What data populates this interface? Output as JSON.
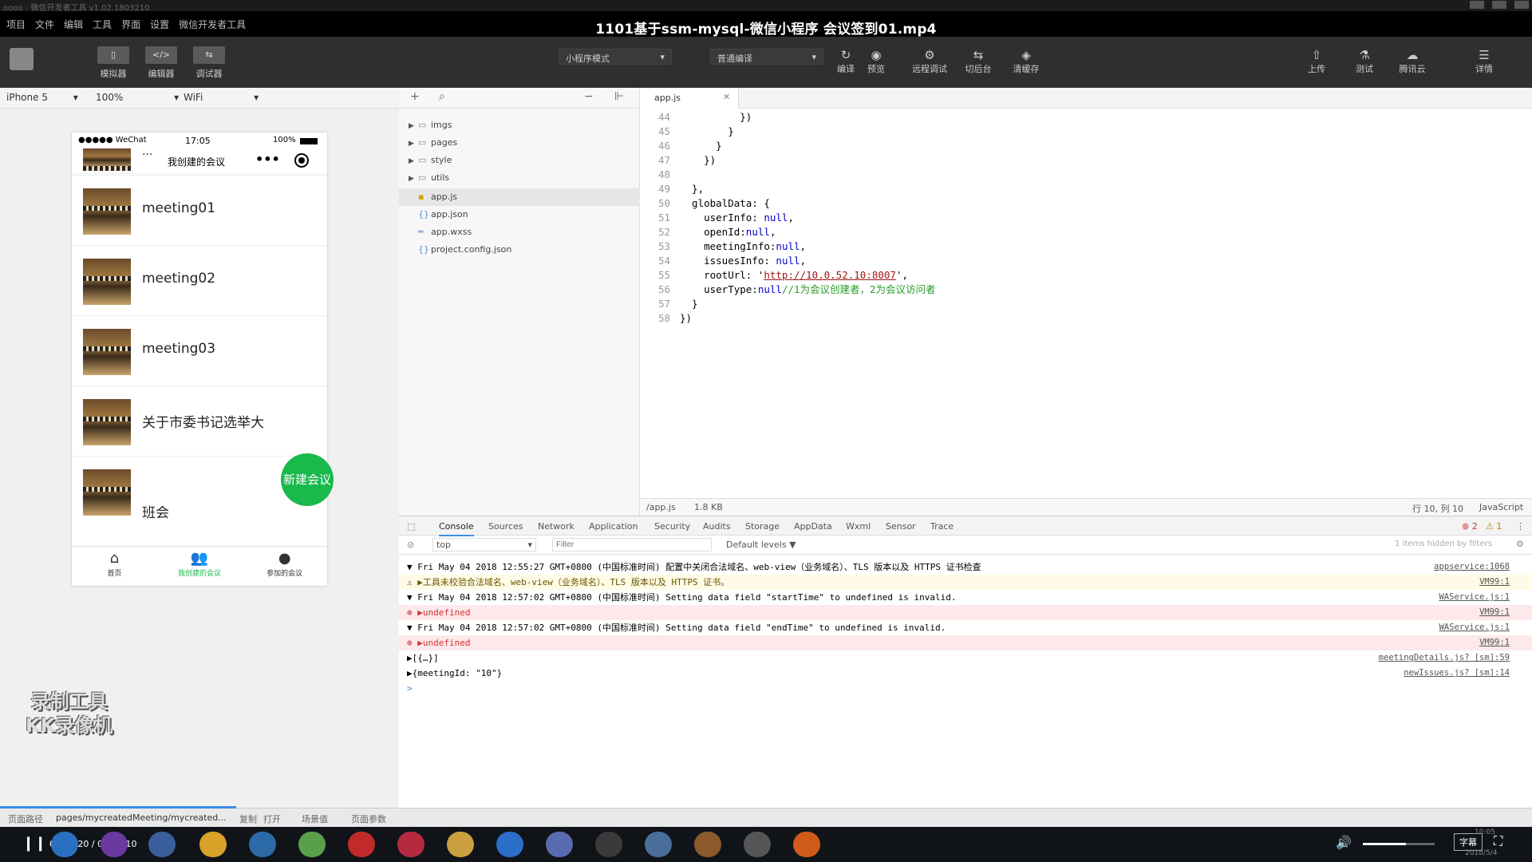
{
  "window": {
    "app_title": "oooo - 微信开发者工具 v1.02.1803210",
    "video_title": "1101基于ssm-mysql-微信小程序 会议签到01.mp4"
  },
  "menu": [
    "项目",
    "文件",
    "编辑",
    "工具",
    "界面",
    "设置",
    "微信开发者工具"
  ],
  "toolbar": {
    "left_buttons": [
      {
        "label": "模拟器",
        "icon": "phone-icon"
      },
      {
        "label": "编辑器",
        "icon": "code-icon"
      },
      {
        "label": "调试器",
        "icon": "debug-icon"
      }
    ],
    "mode_select": "小程序模式",
    "compile_select": "普通编译",
    "actions": [
      {
        "label": "编译",
        "icon": "refresh-icon",
        "glyph": "↻"
      },
      {
        "label": "预览",
        "icon": "eye-icon",
        "glyph": "◉"
      },
      {
        "label": "远程调试",
        "icon": "remote-debug-icon",
        "glyph": "⚙"
      },
      {
        "label": "切后台",
        "icon": "background-icon",
        "glyph": "⇆"
      },
      {
        "label": "清缓存",
        "icon": "clear-cache-icon",
        "glyph": "◈"
      }
    ],
    "right_actions": [
      {
        "label": "上传",
        "icon": "upload-icon",
        "glyph": "⇧"
      },
      {
        "label": "测试",
        "icon": "test-icon",
        "glyph": "⚗"
      },
      {
        "label": "腾讯云",
        "icon": "cloud-icon",
        "glyph": "☁"
      },
      {
        "label": "详情",
        "icon": "menu-icon",
        "glyph": "☰"
      }
    ]
  },
  "device": {
    "model": "iPhone 5",
    "zoom": "100%",
    "network": "WiFi"
  },
  "phone": {
    "carrier": "●●●●● WeChat",
    "time": "17:05",
    "battery": "100%",
    "nav_title": "我创建的会议",
    "partial_item": "...",
    "meetings": [
      "meeting01",
      "meeting02",
      "meeting03",
      "关于市委书记选举大"
    ],
    "last_item": "班会",
    "fab_label": "新建会议",
    "tabs": [
      "首页",
      "我创建的会议",
      "参加的会议"
    ]
  },
  "watermark": [
    "录制工具",
    "KK录像机"
  ],
  "filetree": {
    "items": [
      {
        "name": "imgs",
        "type": "folder"
      },
      {
        "name": "pages",
        "type": "folder"
      },
      {
        "name": "style",
        "type": "folder"
      },
      {
        "name": "utils",
        "type": "folder"
      },
      {
        "name": "app.js",
        "type": "js"
      },
      {
        "name": "app.json",
        "type": "json"
      },
      {
        "name": "app.wxss",
        "type": "wxss"
      },
      {
        "name": "project.config.json",
        "type": "json"
      }
    ]
  },
  "editor": {
    "tab": "app.js",
    "lines": [
      {
        "n": "44",
        "text": "          })"
      },
      {
        "n": "45",
        "text": "        }"
      },
      {
        "n": "46",
        "text": "      }"
      },
      {
        "n": "47",
        "text": "    })"
      },
      {
        "n": "48",
        "text": ""
      },
      {
        "n": "49",
        "text": "  },"
      },
      {
        "n": "50",
        "text": "  globalData: {"
      },
      {
        "n": "51",
        "text": "    userInfo: ",
        "kw": "null",
        "tail": ","
      },
      {
        "n": "52",
        "text": "    openId:",
        "kw": "null",
        "tail": ","
      },
      {
        "n": "53",
        "text": "    meetingInfo:",
        "kw": "null",
        "tail": ","
      },
      {
        "n": "54",
        "text": "    issuesInfo: ",
        "kw": "null",
        "tail": ","
      },
      {
        "n": "55",
        "text": "    rootUrl: '",
        "str": "http://10.0.52.10:8007",
        "tail": "',"
      },
      {
        "n": "56",
        "text": "    userType:",
        "kw": "null",
        "cm": "//1为会议创建者，2为会议访问者"
      },
      {
        "n": "57",
        "text": "  }"
      },
      {
        "n": "58",
        "text": "})"
      }
    ],
    "status_path": "/app.js",
    "status_size": "1.8 KB",
    "status_pos": "行 10, 列 10",
    "status_lang": "JavaScript"
  },
  "console": {
    "tabs": [
      "Console",
      "Sources",
      "Network",
      "Application",
      "Security",
      "Audits",
      "Storage",
      "AppData",
      "Wxml",
      "Sensor",
      "Trace"
    ],
    "error_count": "2",
    "warn_count": "1",
    "context": "top",
    "filter_placeholder": "Filter",
    "levels": "Default levels ▼",
    "hidden_note": "1 items hidden by filters",
    "lines": [
      {
        "type": "log",
        "text": "▼ Fri May 04 2018 12:55:27 GMT+0800 (中国标准时间) 配置中关闭合法域名、web-view（业务域名）、TLS 版本以及 HTTPS 证书检查",
        "src": "appservice:1068"
      },
      {
        "type": "warn",
        "text": "  ⚠ ▶工具未校验合法域名、web-view（业务域名）、TLS 版本以及 HTTPS 证书。",
        "src": "VM99:1"
      },
      {
        "type": "log",
        "text": "▼ Fri May 04 2018 12:57:02 GMT+0800 (中国标准时间) Setting data field \"startTime\" to undefined is invalid.",
        "src": "WAService.js:1"
      },
      {
        "type": "err",
        "text": "  ⊗ ▶undefined",
        "src": "VM99:1"
      },
      {
        "type": "log",
        "text": "▼ Fri May 04 2018 12:57:02 GMT+0800 (中国标准时间) Setting data field \"endTime\" to undefined is invalid.",
        "src": "WAService.js:1"
      },
      {
        "type": "err",
        "text": "  ⊗ ▶undefined",
        "src": "VM99:1"
      },
      {
        "type": "log",
        "text": "  ▶[{…}]",
        "src": "meetingDetails.js? [sm]:59"
      },
      {
        "type": "log",
        "text": "  ▶{meetingId: \"10\"}",
        "src": "newIssues.js? [sm]:14"
      },
      {
        "type": "prompt",
        "text": ">",
        "src": ""
      }
    ]
  },
  "pathbar": {
    "label": "页面路径",
    "path": "pages/mycreatedMeeting/mycreated...",
    "copy": "复制",
    "open": "打开",
    "scene": "场景值",
    "params": "页面参数"
  },
  "player": {
    "time": "00:00:20 / 00:02:10",
    "subtitle_btn": "字幕",
    "clock": "10:05",
    "date": "2018/5/4",
    "progress": 0.154,
    "volume": 0.6
  },
  "colors": {
    "accent_green": "#19b94c",
    "toolbar": "#2f2f2f",
    "error": "#c33"
  }
}
